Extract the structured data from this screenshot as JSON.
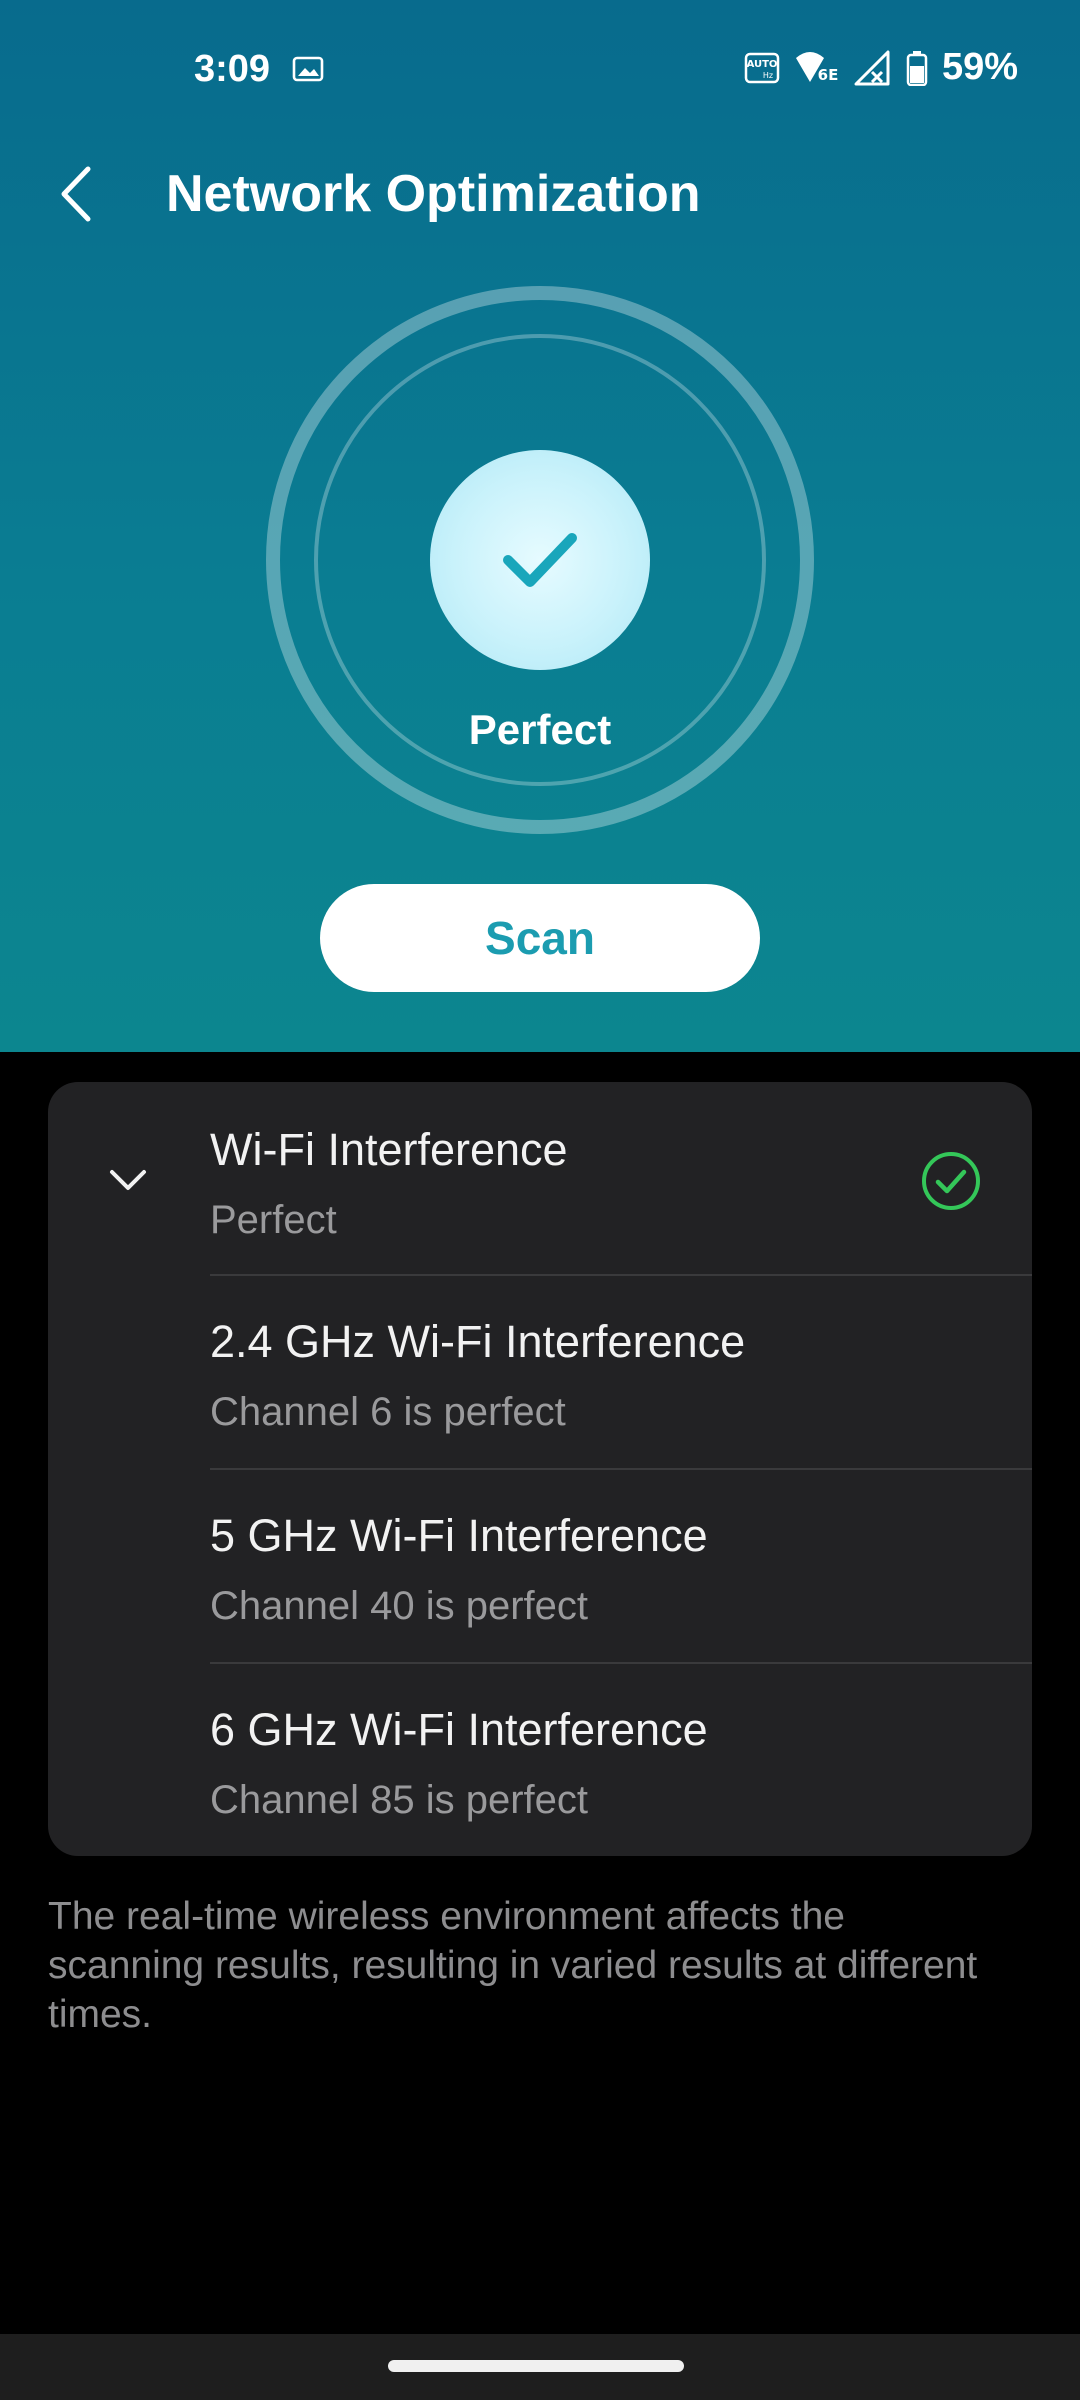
{
  "status_bar": {
    "time": "3:09",
    "battery": "59%",
    "icons": [
      "gallery-icon",
      "auto-hz-icon",
      "wifi-6e-icon",
      "cellular-no-signal-icon",
      "battery-icon"
    ]
  },
  "app_bar": {
    "title": "Network Optimization",
    "back_icon": "chevron-left-icon"
  },
  "status": {
    "label": "Perfect",
    "icon": "checkmark-icon"
  },
  "scan_button": {
    "label": "Scan"
  },
  "interference": {
    "header": {
      "title": "Wi-Fi Interference",
      "subtitle": "Perfect",
      "expand_icon": "chevron-down-icon",
      "status_icon": "check-circle-icon"
    },
    "items": [
      {
        "title": "2.4 GHz Wi-Fi Interference",
        "subtitle": "Channel 6 is perfect"
      },
      {
        "title": "5 GHz Wi-Fi Interference",
        "subtitle": "Channel 40 is perfect"
      },
      {
        "title": "6 GHz Wi-Fi Interference",
        "subtitle": "Channel 85 is perfect"
      }
    ]
  },
  "footnote": "The real-time wireless environment affects the scanning results, resulting in varied results at different times.",
  "colors": {
    "hero_top": "#086b8d",
    "hero_bottom": "#0c868f",
    "accent": "#1b9cb0",
    "success": "#34c759",
    "card_bg": "#222224"
  }
}
